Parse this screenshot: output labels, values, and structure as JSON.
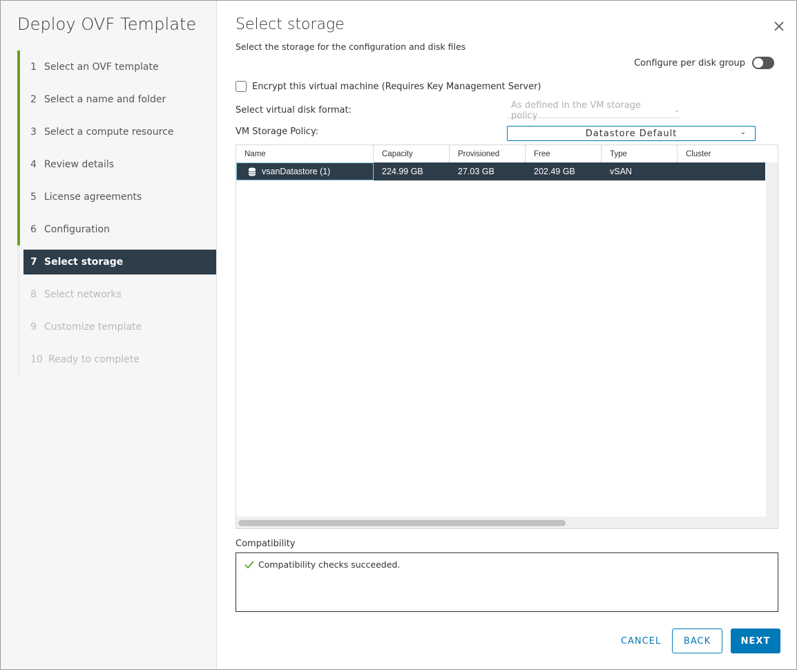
{
  "wizard": {
    "title": "Deploy OVF Template",
    "steps": [
      {
        "num": "1",
        "label": "Select an OVF template"
      },
      {
        "num": "2",
        "label": "Select a name and folder"
      },
      {
        "num": "3",
        "label": "Select a compute resource"
      },
      {
        "num": "4",
        "label": "Review details"
      },
      {
        "num": "5",
        "label": "License agreements"
      },
      {
        "num": "6",
        "label": "Configuration"
      },
      {
        "num": "7",
        "label": "Select storage"
      },
      {
        "num": "8",
        "label": "Select networks"
      },
      {
        "num": "9",
        "label": "Customize template"
      },
      {
        "num": "10",
        "label": "Ready to complete"
      }
    ]
  },
  "page": {
    "title": "Select storage",
    "subtitle": "Select the storage for the configuration and disk files"
  },
  "options": {
    "per_disk_label": "Configure per disk group",
    "per_disk_enabled": false,
    "encrypt_label": "Encrypt this virtual machine (Requires Key Management Server)",
    "encrypt_checked": false,
    "disk_format_label": "Select virtual disk format:",
    "disk_format_value": "As defined in the VM storage policy",
    "policy_label": "VM Storage Policy:",
    "policy_value": "Datastore Default"
  },
  "table": {
    "columns": [
      "Name",
      "Capacity",
      "Provisioned",
      "Free",
      "Type",
      "Cluster"
    ],
    "rows": [
      {
        "name": "vsanDatastore (1)",
        "capacity": "224.99 GB",
        "provisioned": "27.03 GB",
        "free": "202.49 GB",
        "type": "vSAN",
        "cluster": "",
        "selected": true
      }
    ]
  },
  "compatibility": {
    "label": "Compatibility",
    "message": "Compatibility checks succeeded."
  },
  "buttons": {
    "cancel": "CANCEL",
    "back": "BACK",
    "next": "NEXT"
  },
  "colors": {
    "accent": "#0079b8",
    "done": "#62a420",
    "selected_bg": "#2e3d4a"
  }
}
